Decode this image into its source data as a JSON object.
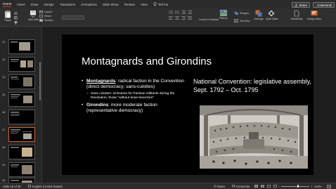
{
  "tabs": [
    "Home",
    "Insert",
    "Draw",
    "Design",
    "Transitions",
    "Animations",
    "Slide Show",
    "Review",
    "View"
  ],
  "tell_me": "Tell me",
  "share_label": "Share",
  "comments_label": "Comments",
  "ribbon": {
    "paste": "Paste",
    "new_slide": "New Slide",
    "layout": "Layout",
    "reset": "Reset",
    "section": "Section",
    "convert_smartart": "Convert to SmartArt",
    "picture": "Picture",
    "shapes": "Shapes",
    "text_box": "Text Box",
    "arrange": "Arrange",
    "quick_styles": "Quick Styles",
    "sensitivity": "Sensitivity",
    "design_ideas": "Design Ideas"
  },
  "thumbnails": [
    {
      "num": "12"
    },
    {
      "num": "13"
    },
    {
      "num": "14"
    },
    {
      "num": "15"
    },
    {
      "num": "16"
    },
    {
      "num": "17"
    },
    {
      "num": "18"
    },
    {
      "num": "19"
    },
    {
      "num": "20"
    }
  ],
  "slide": {
    "title": "Montagnards and Girondins",
    "bullet1_term": "Montagnards",
    "bullet1_rest": ": radical faction in the Convention (direct democracy; sans-culottes)",
    "sub_bullet": "Sans culottes: nickname for Parisian militants during the Revolution; those \"without knee breeches\"",
    "bullet2_term": "Girondins",
    "bullet2_rest": ": more moderate faction (representative democracy)",
    "side_text": "National Convention: legislative assembly, Sept. 1792 – Oct. 1795"
  },
  "status": {
    "slide_count": "Slide 16 of 30",
    "language": "English (United States)",
    "notes": "Notes",
    "comments": "Comments",
    "zoom": "114%"
  },
  "colors": {
    "accent": "#c43e1c",
    "selection": "#d2642b"
  }
}
